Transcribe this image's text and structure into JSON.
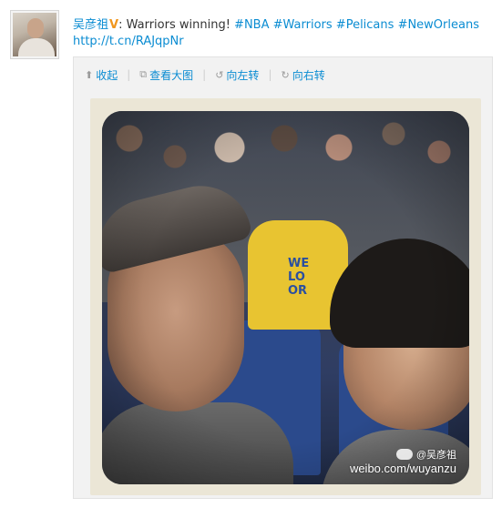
{
  "post": {
    "username": "吴彦祖",
    "verified_badge": "V",
    "colon": ":",
    "text_prefix": "Warriors winning! ",
    "tags": [
      "#NBA",
      "#Warriors",
      "#Pelicans",
      "#NewOrleans"
    ],
    "link": "http://t.cn/RAJqpNr"
  },
  "toolbar": {
    "collapse_label": "收起",
    "view_large_label": "查看大图",
    "rotate_left_label": "向左转",
    "rotate_right_label": "向右转",
    "icons": {
      "collapse": "up-arrow-icon",
      "view_large": "external-view-icon",
      "rotate_left": "rotate-left-icon",
      "rotate_right": "rotate-right-icon"
    }
  },
  "photo": {
    "shirt_text_1": "WE",
    "shirt_text_2": "LO",
    "shirt_text_3": "OR",
    "watermark_handle": "@吴彦祖",
    "watermark_site": "weibo.com/wuyanzu"
  },
  "colors": {
    "link_blue": "#0a8cd2",
    "vip_orange": "#f0961e",
    "text": "#333333",
    "panel_bg": "#f2f2f2",
    "photo_frame": "#ebe6d6"
  }
}
